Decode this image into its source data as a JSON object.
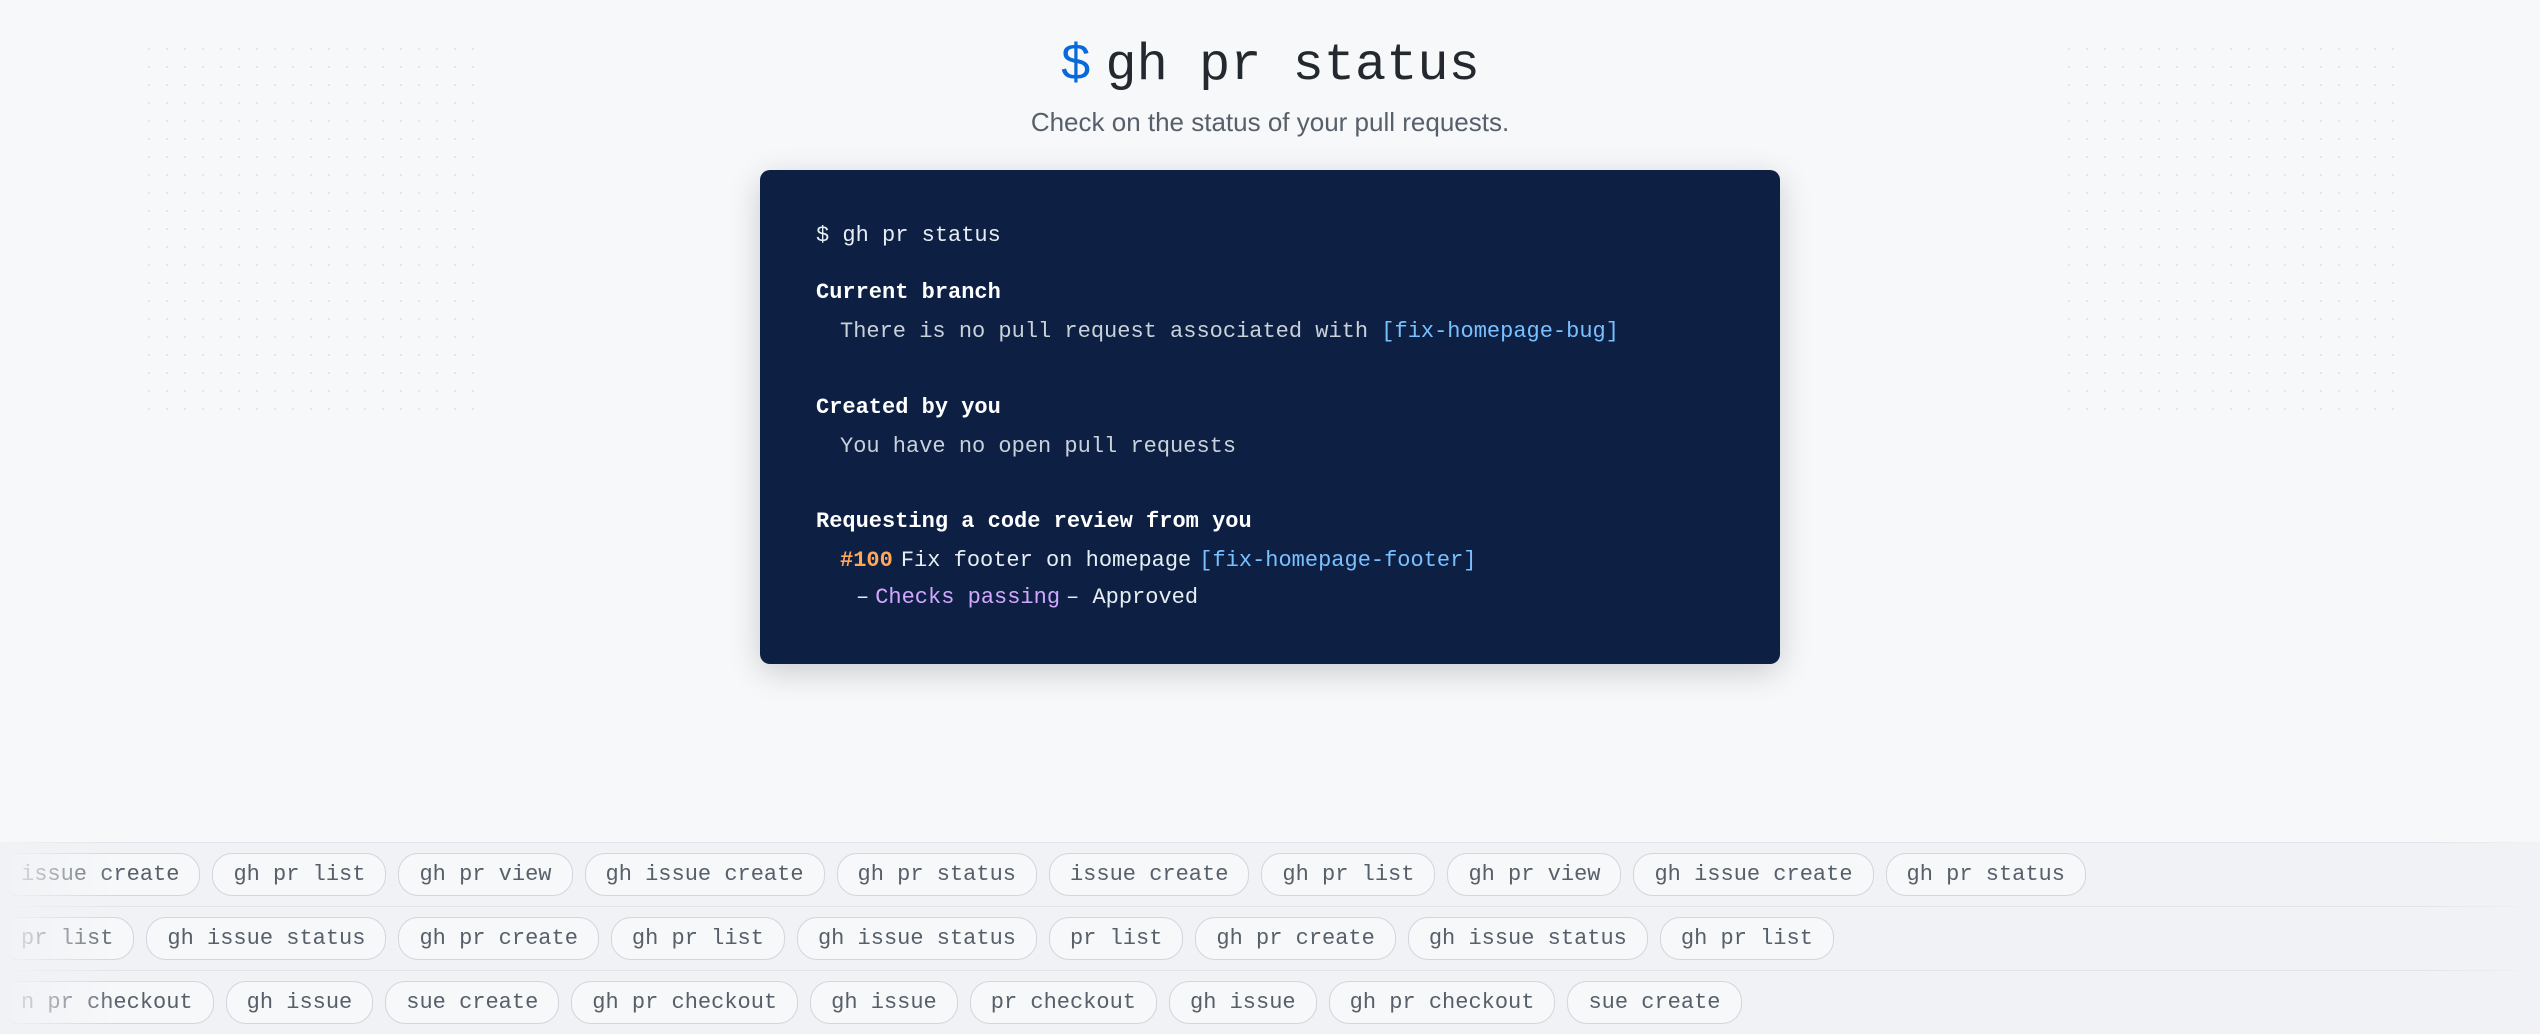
{
  "page": {
    "background_color": "#f6f8fa"
  },
  "header": {
    "dollar_sign": "$",
    "title_command": "gh pr status",
    "subtitle": "Check on the status of your pull requests."
  },
  "terminal": {
    "prompt_line": "$ gh pr status",
    "sections": [
      {
        "header": "Current branch",
        "body": "There is no pull request associated with [fix-homepage-bug]"
      },
      {
        "header": "Created by you",
        "body": "You have no open pull requests"
      },
      {
        "header": "Requesting a code review from you",
        "pr_number": "#100",
        "pr_title": "Fix footer on homepage",
        "pr_branch": "[fix-homepage-footer]",
        "checks_label": "Checks passing",
        "approved_label": "– Approved"
      }
    ]
  },
  "pills_rows": [
    {
      "id": "row1",
      "pills": [
        "issue create",
        "gh pr list",
        "gh pr view",
        "gh issue create",
        "gh pr status",
        "issue create",
        "gh pr list"
      ]
    },
    {
      "id": "row2",
      "pills": [
        "pr list",
        "gh issue status",
        "gh pr create",
        "gh pr list",
        "gh issue status",
        "pr list",
        "gh issue status"
      ]
    },
    {
      "id": "row3",
      "pills": [
        "n pr checkout",
        "gh issue",
        "sue create",
        "gh pr checkout",
        "gh issue",
        "pr checkout",
        "gh issue"
      ]
    }
  ]
}
